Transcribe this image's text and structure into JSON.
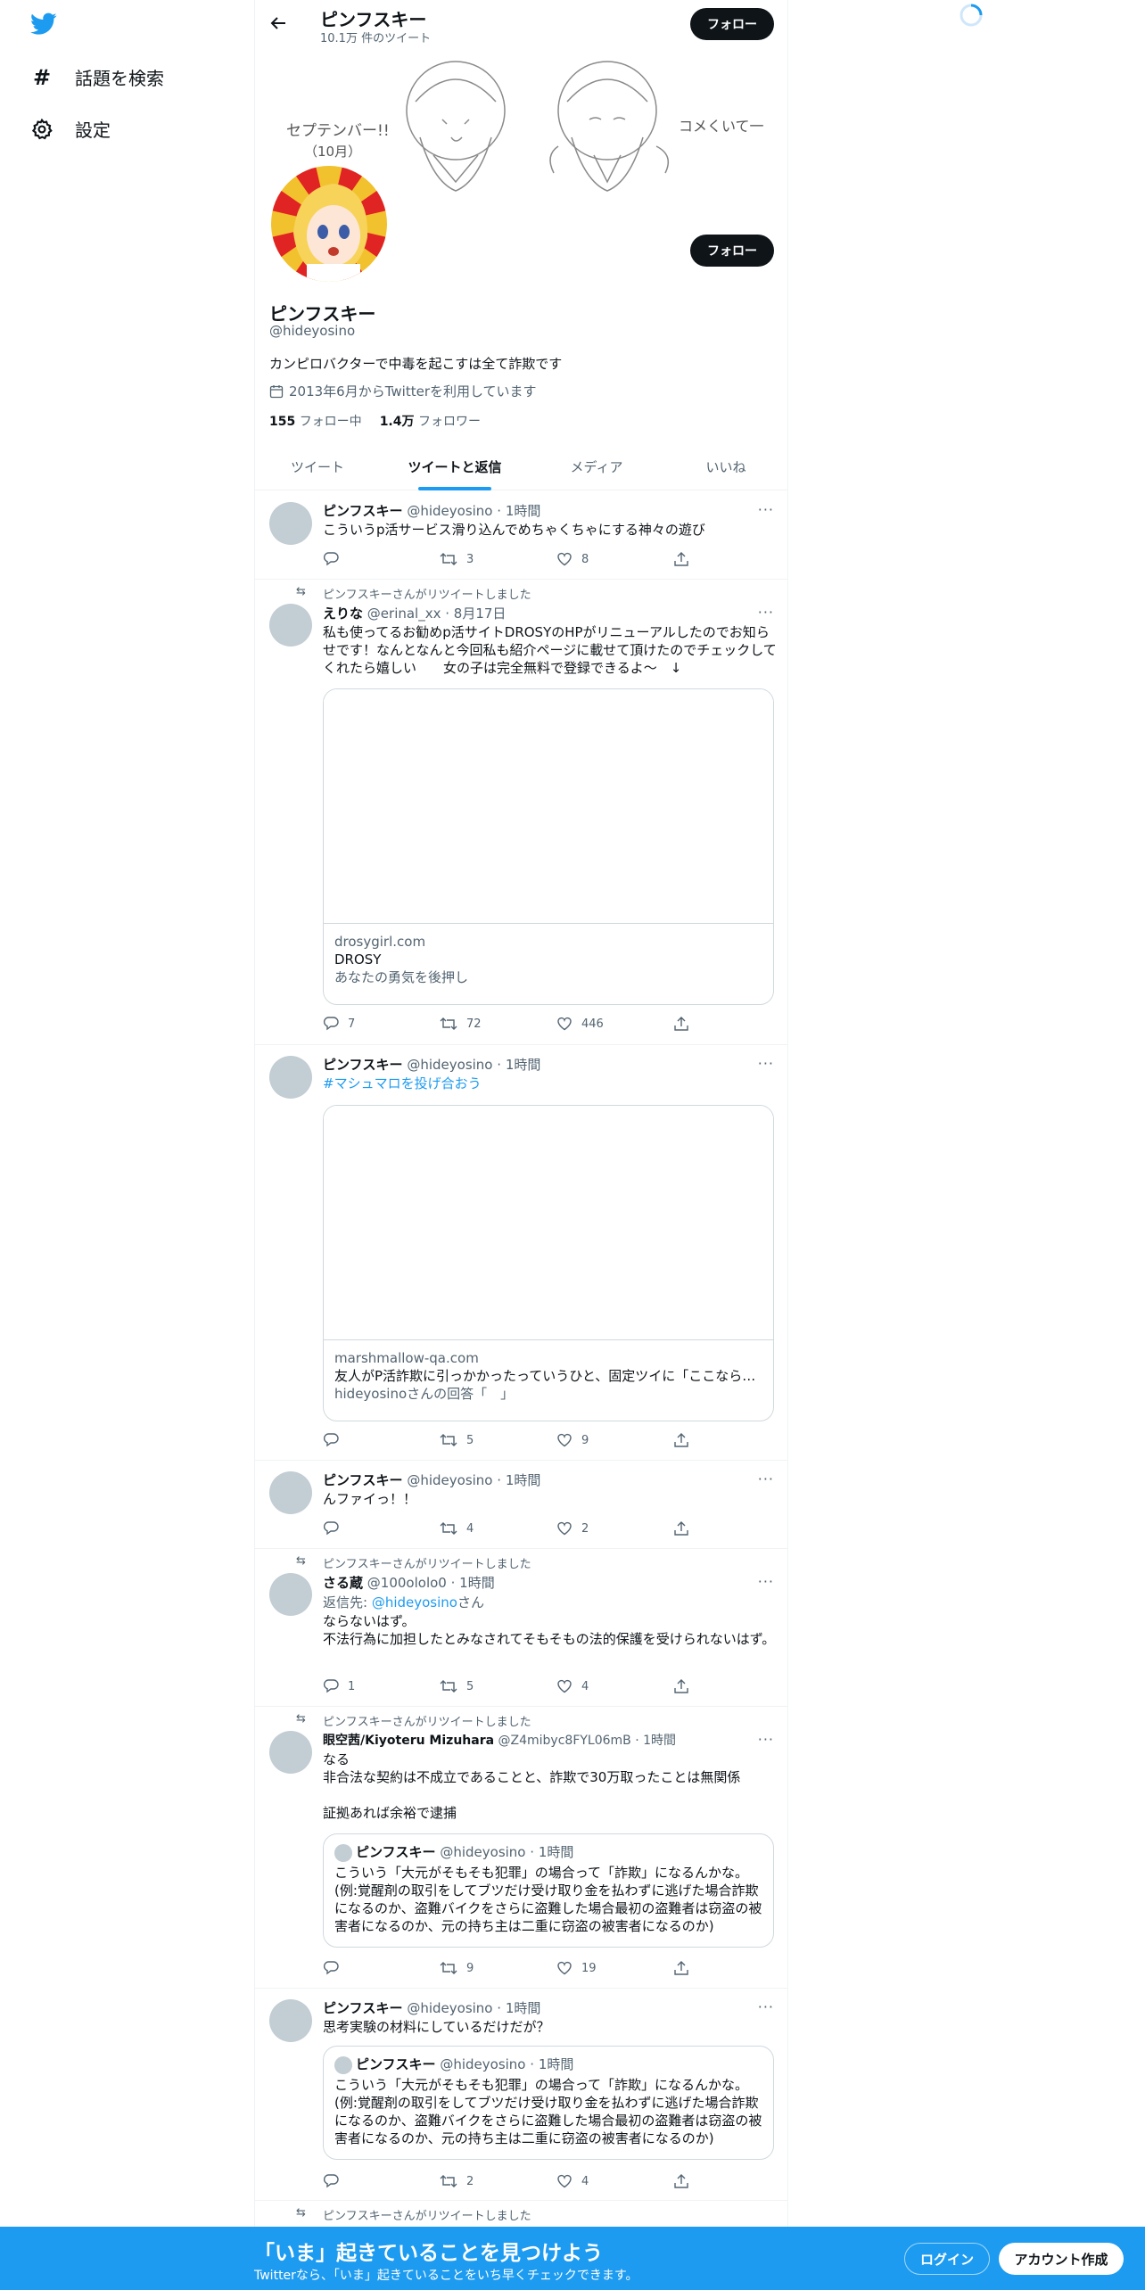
{
  "nav": {
    "explore_label": "話題を検索",
    "settings_label": "設定"
  },
  "header": {
    "title": "ピンフスキー",
    "subtitle": "10.1万 件のツイート",
    "follow_label": "フォロー"
  },
  "profile": {
    "name": "ピンフスキー",
    "handle": "@hideyosino",
    "bio": "カンピロバクターで中毒を起こすは全て詐欺です",
    "joined": "2013年6月からTwitterを利用しています",
    "following_count": "155",
    "following_label": "フォロー中",
    "followers_count": "1.4万",
    "followers_label": "フォロワー",
    "follow_label": "フォロー",
    "banner_text_left": "セプテンバー!!\n（10月）",
    "banner_text_right": "コメくいて一"
  },
  "tabs": [
    {
      "label": "ツイート"
    },
    {
      "label": "ツイートと返信"
    },
    {
      "label": "メディア"
    },
    {
      "label": "いいね"
    }
  ],
  "tweets": [
    {
      "name": "ピンフスキー",
      "handle": "@hideyosino",
      "time": "· 1時間",
      "text": "こういうp活サービス滑り込んでめちゃくちゃにする神々の遊び",
      "replies": "",
      "retweets": "3",
      "likes": "8"
    },
    {
      "retweeted_by": "ピンフスキーさんがリツイートしました",
      "name": "えりな",
      "handle": "@erinal_xx",
      "time": "· 8月17日",
      "text": "私も使ってるお勧めp活サイトDROSYのHPがリニューアルしたのでお知らせです！なんとなんと今回私も紹介ページに載せて頂けたのでチェックしてくれたら嬉しい　　女の子は完全無料で登録できるよ〜　↓",
      "card_domain": "drosygirl.com",
      "card_title": "DROSY",
      "card_desc": "あなたの勇気を後押し",
      "replies": "7",
      "retweets": "72",
      "likes": "446"
    },
    {
      "name": "ピンフスキー",
      "handle": "@hideyosino",
      "time": "· 1時間",
      "text": "#マシュマロを投げ合おう",
      "card_domain": "marshmallow-qa.com",
      "card_title": "友人がP活詐欺に引っかかったっていうひと、固定ツイに「ここなら…",
      "card_desc": "hideyosinoさんの回答「　」",
      "replies": "",
      "retweets": "5",
      "likes": "9"
    },
    {
      "name": "ピンフスキー",
      "handle": "@hideyosino",
      "time": "· 1時間",
      "text": "んファイっ！！",
      "replies": "",
      "retweets": "4",
      "likes": "2"
    },
    {
      "retweeted_by": "ピンフスキーさんがリツイートしました",
      "name": "さる蔵",
      "handle": "@100ololo0",
      "time": "· 1時間",
      "reply_to_prefix": "返信先: ",
      "reply_to_handle": "@hideyosino",
      "reply_to_suffix": "さん",
      "text": "ならないはず。\n不法行為に加担したとみなされてそもそもの法的保護を受けられないはず。",
      "replies": "1",
      "retweets": "5",
      "likes": "4"
    },
    {
      "retweeted_by": "ピンフスキーさんがリツイートしました",
      "name": "眼空茜/Kiyoteru Mizuhara",
      "handle": "@Z4mibyc8FYL06mB",
      "time": "· 1時間",
      "text": "なる\n非合法な契約は不成立であることと、詐欺で30万取ったことは無関係\n\n証拠あれば余裕で逮捕",
      "quote_name": "ピンフスキー",
      "quote_handle": "@hideyosino",
      "quote_time": "· 1時間",
      "quote_text": "こういう「大元がそもそも犯罪」の場合って「詐欺」になるんかな。\n(例:覚醒剤の取引をしてブツだけ受け取り金を払わずに逃げた場合詐欺になるのか、盗難バイクをさらに盗難した場合最初の盗難者は窃盗の被害者になるのか、元の持ち主は二重に窃盗の被害者になるのか)",
      "replies": "",
      "retweets": "9",
      "likes": "19"
    },
    {
      "name": "ピンフスキー",
      "handle": "@hideyosino",
      "time": "· 1時間",
      "text": "思考実験の材料にしているだけだが？",
      "quote_name": "ピンフスキー",
      "quote_handle": "@hideyosino",
      "quote_time": "· 1時間",
      "quote_text": "こういう「大元がそもそも犯罪」の場合って「詐欺」になるんかな。\n(例:覚醒剤の取引をしてブツだけ受け取り金を払わずに逃げた場合詐欺になるのか、盗難バイクをさらに盗難した場合最初の盗難者は窃盗の被害者になるのか、元の持ち主は二重に窃盗の被害者になるのか)",
      "replies": "",
      "retweets": "2",
      "likes": "4"
    },
    {
      "retweeted_by": "ピンフスキーさんがリツイートしました"
    }
  ],
  "banner": {
    "title": "「いま」起きていることを見つけよう",
    "subtitle": "Twitterなら、「いま」起きていることをいち早くチェックできます。",
    "login_label": "ログイン",
    "signup_label": "アカウント作成"
  },
  "colors": {
    "accent": "#1d9bf0",
    "dark": "#0f1419",
    "muted": "#536471"
  }
}
